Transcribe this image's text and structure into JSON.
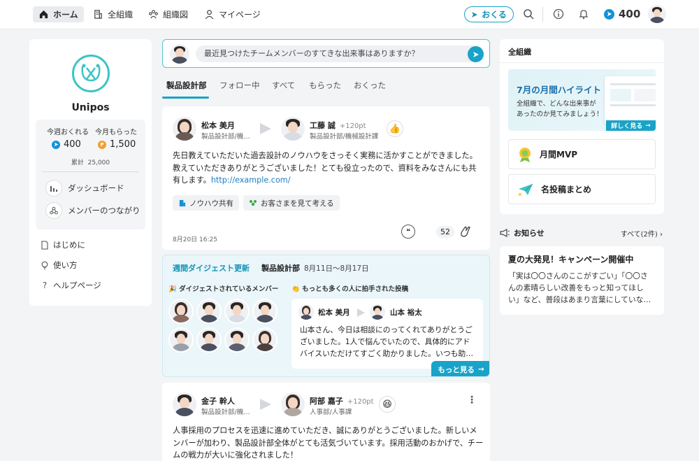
{
  "header": {
    "nav": [
      {
        "label": "ホーム",
        "icon": "home-icon"
      },
      {
        "label": "全組織",
        "icon": "building-icon"
      },
      {
        "label": "組織図",
        "icon": "org-chart-icon"
      },
      {
        "label": "マイページ",
        "icon": "person-icon"
      }
    ],
    "send_label": "おくる",
    "points": "400"
  },
  "left": {
    "brand": "Unipos",
    "stats": {
      "send_label": "今週おくれる",
      "send_value": "400",
      "recv_label": "今月もらった",
      "recv_value": "1,500",
      "total_label": "累計",
      "total_value": "25,000"
    },
    "links": [
      "ダッシュボード",
      "メンバーのつながり"
    ],
    "menu": [
      "はじめに",
      "使い方",
      "ヘルプページ"
    ]
  },
  "composer": {
    "placeholder": "最近見つけたチームメンバーのすてきな出来事はありますか？"
  },
  "tabs": [
    "製品設計部",
    "フォロー中",
    "すべて",
    "もらった",
    "おくった"
  ],
  "post1": {
    "from_name": "松本 美月",
    "from_dept": "製品設計部/機…",
    "to_name": "工藤 誠",
    "to_pt": "+120pt",
    "to_dept": "製品設計部/機械設計課",
    "emoji": "👍",
    "text1": "先日教えていただいた過去設計のノウハウをさっそく実務に活かすことができました。",
    "text2": "教えていただきありがとうございました！とても役立ったので、資料をみなさんにも共",
    "text3": "有します。",
    "link": "http://example.com/",
    "tags": [
      "ノウハウ共有",
      "お客さまを見て考える"
    ],
    "time": "8月20日 16:25",
    "clap_count": "52"
  },
  "digest": {
    "title": "週間ダイジェスト更新",
    "dept": "製品設計部",
    "date": "8月11日〜8月17日",
    "members_label": "ダイジェストされているメンバー",
    "top_label": "もっとも多くの人に拍手された投稿",
    "from_name": "松本 美月",
    "to_name": "山本 裕太",
    "text1": "山本さん、今日は相談にのってくれてありがとうご",
    "text2": "ざいました。1人で悩んでいたので、具体的にアド",
    "text3": "バイスいただけてすごく助かりました。いつも助…",
    "more": "もっと見る"
  },
  "post2": {
    "from_name": "金子 幹人",
    "from_dept": "製品設計部/機…",
    "to_name": "阿部 嘉子",
    "to_pt": "+120pt",
    "to_dept": "人事部/人事課",
    "emoji": "😆",
    "text1": "人事採用のプロセスを迅速に進めていただき、誠にありがとうございました。新しいメ",
    "text2": "ンバーが加わり、製品設計部全体がとても活気づいています。採用活動のおかげで、チー",
    "text3": "ムの戦力が大いに強化されました！"
  },
  "right": {
    "title": "全組織",
    "banner_title": "7月の月間ハイライト",
    "banner_text1": "全組織で、どんな出来事が",
    "banner_text2": "あったのか見てみましょう！",
    "banner_btn": "詳しく見る",
    "mvp": "月間MVP",
    "summary": "名投稿まとめ",
    "notice_title": "お知らせ",
    "notice_all": "すべて(2件)",
    "notice_card_title": "夏の大発見！キャンペーン開催中",
    "notice_card_text1": "「実は〇〇さんのここがすごい」「〇〇さ",
    "notice_card_text2": "んの素晴らしい改善をもっと知ってほし",
    "notice_card_text3": "い」など、普段はあまり言葉にしていな…"
  }
}
